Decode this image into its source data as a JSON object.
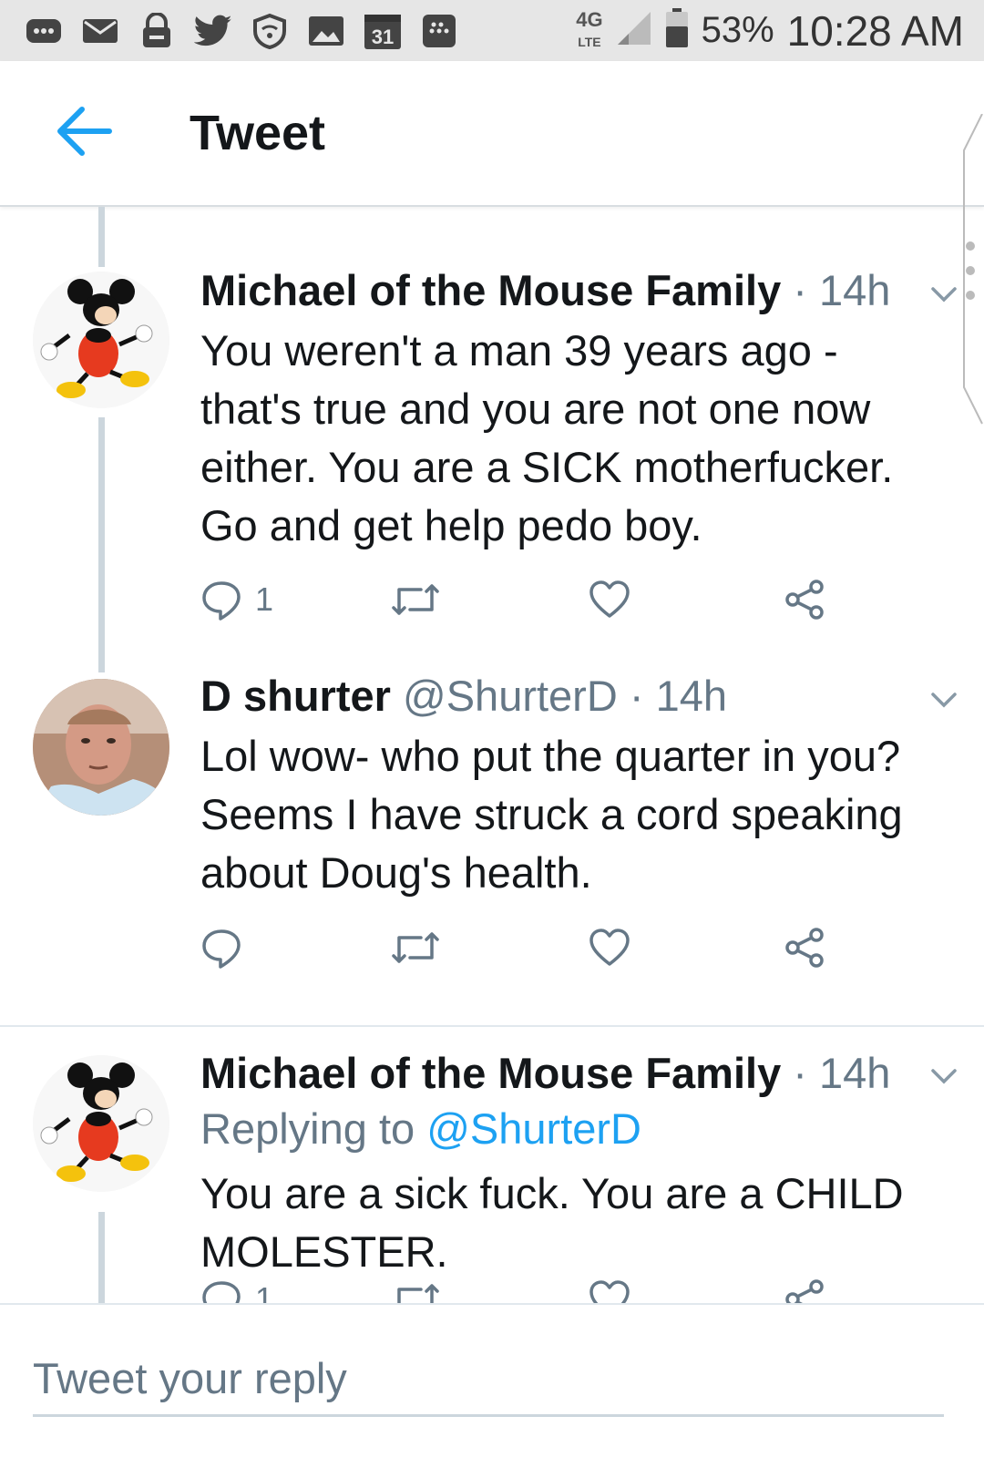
{
  "status_bar": {
    "calendar_day": "31",
    "network": "4G",
    "network_sub": "LTE",
    "battery": "53%",
    "time": "10:28 AM"
  },
  "header": {
    "title": "Tweet"
  },
  "tweets": [
    {
      "name": "Michael of the Mouse Family",
      "handle": "",
      "time": "14h",
      "replying_prefix": "",
      "replying_to": "",
      "text": "You weren't a man 39 years ago - that's true and you are not one now either. You are a SICK motherfucker. Go and get help pedo boy.",
      "reply_count": "1",
      "avatar_icon": "mickey-mouse-avatar"
    },
    {
      "name": "D shurter",
      "handle": "@ShurterD",
      "time": "14h",
      "replying_prefix": "",
      "replying_to": "",
      "text": "Lol wow- who put the quarter in you? Seems I have struck a cord speaking about Doug's health.",
      "reply_count": "",
      "avatar_icon": "man-photo-avatar"
    },
    {
      "name": "Michael of the Mouse Family",
      "handle": "",
      "time": "14h",
      "replying_prefix": "Replying to",
      "replying_to": "@ShurterD",
      "text": "You are a sick fuck. You are a CHILD MOLESTER.",
      "reply_count": "1",
      "avatar_icon": "mickey-mouse-avatar"
    }
  ],
  "reply_bar": {
    "placeholder": "Tweet your reply"
  },
  "colors": {
    "accent": "#1da1f2",
    "muted": "#657786",
    "thread": "#ccd6dd"
  }
}
